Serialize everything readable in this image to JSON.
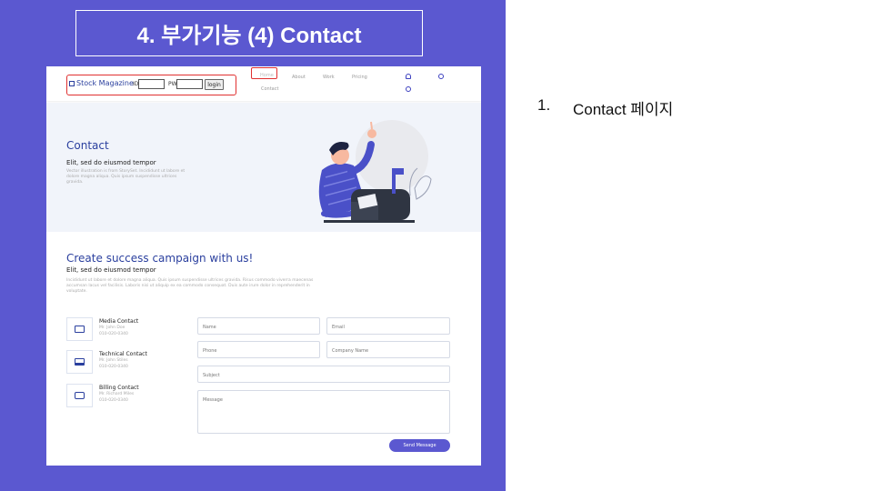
{
  "slide": {
    "title": "4. 부가기능 (4) Contact",
    "note": {
      "number": "1.",
      "text": "Contact 페이지"
    }
  },
  "nav": {
    "brand": "Stock Magazine",
    "id_label": "ID",
    "id_value": "",
    "pw_label": "PW",
    "pw_value": "",
    "login_label": "login",
    "links": [
      "Home",
      "About",
      "Work",
      "Pricing",
      "Contact"
    ],
    "icons": [
      "bell-icon",
      "settings-icon",
      "settings-icon"
    ]
  },
  "hero": {
    "title": "Contact",
    "subtitle": "Elit, sed do eiusmod tempor",
    "body": "Vector illustration is from StorySet. Incididunt ut labore et dolore magna aliqua. Quis ipsum suspendisse ultrices gravida."
  },
  "cta": {
    "title": "Create success campaign with us!",
    "subtitle": "Elit, sed do eiusmod tempor",
    "body": "Incididunt ut labore et dolore magna aliqua. Quis ipsum suspendisse ultrices gravida. Risus commodo viverra maecenas accumsan lacus vel facilisis. Laboris nisi ut aliquip ex ea commodo consequat. Duis aute irure dolor in reprehenderit in voluptate."
  },
  "contacts": [
    {
      "title": "Media Contact",
      "name": "Mr. John Doe",
      "phone": "010-020-0340",
      "icon": "id-card-icon"
    },
    {
      "title": "Technical Contact",
      "name": "Mr. John Stiles",
      "phone": "010-020-0340",
      "icon": "laptop-icon"
    },
    {
      "title": "Billing Contact",
      "name": "Mr. Richard Miles",
      "phone": "010-020-0340",
      "icon": "money-icon"
    }
  ],
  "form": {
    "name_placeholder": "Name",
    "email_placeholder": "Email",
    "phone_placeholder": "Phone",
    "company_placeholder": "Company Name",
    "subject_placeholder": "Subject",
    "message_placeholder": "Message",
    "send_label": "Send Message"
  },
  "colors": {
    "panel": "#5b58d0",
    "accent": "#2a3f9e",
    "highlight": "#e03030"
  }
}
